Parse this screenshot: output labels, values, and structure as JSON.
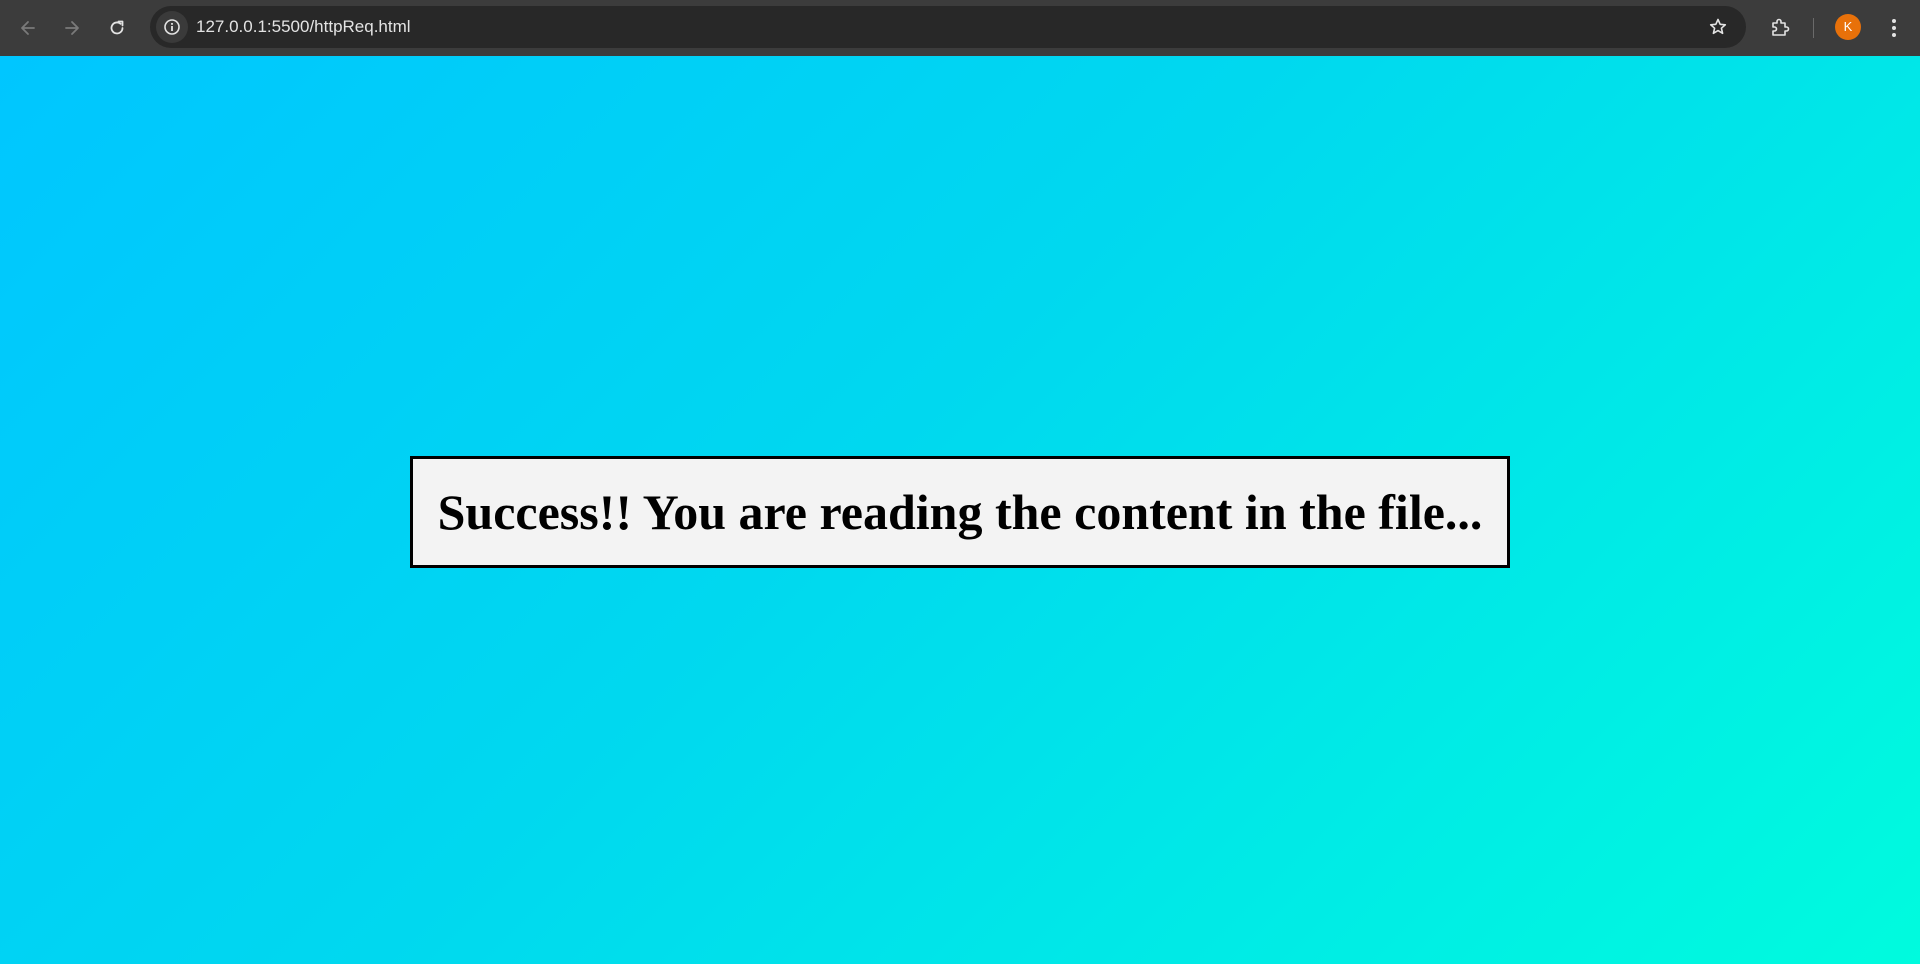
{
  "browser": {
    "back_icon": "arrow-left-icon",
    "forward_icon": "arrow-right-icon",
    "reload_icon": "reload-icon",
    "site_info_icon": "info-icon",
    "url": "127.0.0.1:5500/httpReq.html",
    "bookmark_icon": "star-icon",
    "extensions_icon": "puzzle-icon",
    "profile_initial": "K",
    "profile_color": "#e8710a",
    "menu_icon": "vertical-dots-icon"
  },
  "page": {
    "message": "Success!! You are reading the content in the file...",
    "background_gradient": [
      "#00c6ff",
      "#00fbde"
    ],
    "box_background": "#f3f3f3",
    "box_border_color": "#000000"
  }
}
